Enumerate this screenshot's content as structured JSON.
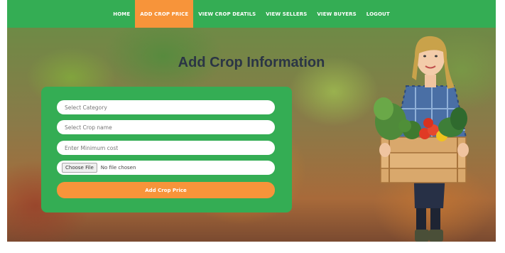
{
  "nav": {
    "items": [
      {
        "label": "HOME"
      },
      {
        "label": "ADD CROP PRICE",
        "active": true
      },
      {
        "label": "VIEW CROP DEATILS"
      },
      {
        "label": "VIEW SELLERS"
      },
      {
        "label": "VIEW BUYERS"
      },
      {
        "label": "LOGOUT"
      }
    ]
  },
  "hero": {
    "title": "Add Crop Information"
  },
  "form": {
    "category_placeholder": "Select Category",
    "crop_name_placeholder": "Select Crop name",
    "min_cost_placeholder": "Enter Minimum cost",
    "file_button": "Choose File",
    "file_status": "No file chosen",
    "submit_label": "Add Crop Price"
  },
  "colors": {
    "primary_green": "#34ad54",
    "accent_orange": "#f7943a",
    "title_color": "#2b3545"
  }
}
